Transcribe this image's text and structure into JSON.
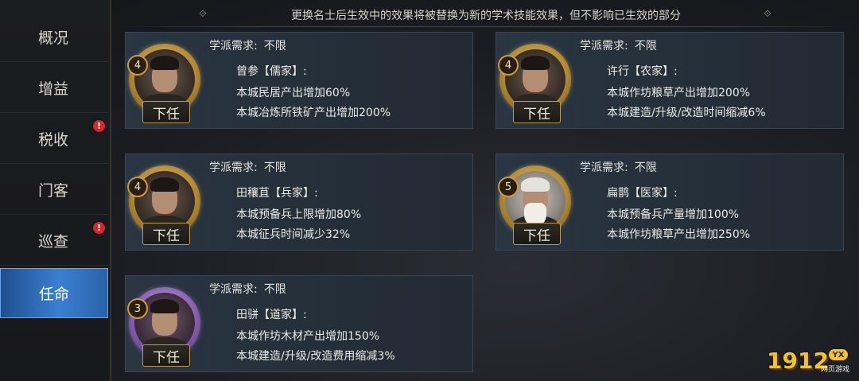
{
  "sidebar": {
    "items": [
      {
        "label": "概况",
        "badge": ""
      },
      {
        "label": "增益",
        "badge": ""
      },
      {
        "label": "税收",
        "badge": "!"
      },
      {
        "label": "门客",
        "badge": ""
      },
      {
        "label": "巡查",
        "badge": "!"
      },
      {
        "label": "任命",
        "badge": "",
        "active": true
      }
    ]
  },
  "notice": "更换名士后生效中的效果将被替换为新的学术技能效果，但不影响已生效的部分",
  "cards": [
    {
      "req_label": "学派需求:",
      "req_value": "不限",
      "name": "曾参【儒家】:",
      "effect1": "本城民居产出增加60%",
      "effect2": "本城冶炼所铁矿产出增加200%",
      "level": "4",
      "button": "下任"
    },
    {
      "req_label": "学派需求:",
      "req_value": "不限",
      "name": "许行【农家】:",
      "effect1": "本城作坊粮草产出增加200%",
      "effect2": "本城建造/升级/改造时间缩减6%",
      "level": "4",
      "button": "下任"
    },
    {
      "req_label": "学派需求:",
      "req_value": "不限",
      "name": "田穰苴【兵家】:",
      "effect1": "本城预备兵上限增加80%",
      "effect2": "本城征兵时间减少32%",
      "level": "4",
      "button": "下任"
    },
    {
      "req_label": "学派需求:",
      "req_value": "不限",
      "name": "扁鹊【医家】:",
      "effect1": "本城预备兵产量增加100%",
      "effect2": "本城作坊粮草产出增加250%",
      "level": "5",
      "button": "下任"
    },
    {
      "req_label": "学派需求:",
      "req_value": "不限",
      "name": "田骈【道家】:",
      "effect1": "本城作坊木材产出增加150%",
      "effect2": "本城建造/升级/改造费用缩减3%",
      "level": "3",
      "button": "下任"
    }
  ],
  "watermark": {
    "number": "1912",
    "tag": "YX",
    "subtitle": "网页游戏"
  },
  "colors": {
    "active_tab": "#3a7fd0",
    "gold_ring": "#b48a34",
    "purple_ring": "#8a5fb0",
    "badge": "#d8262a"
  }
}
